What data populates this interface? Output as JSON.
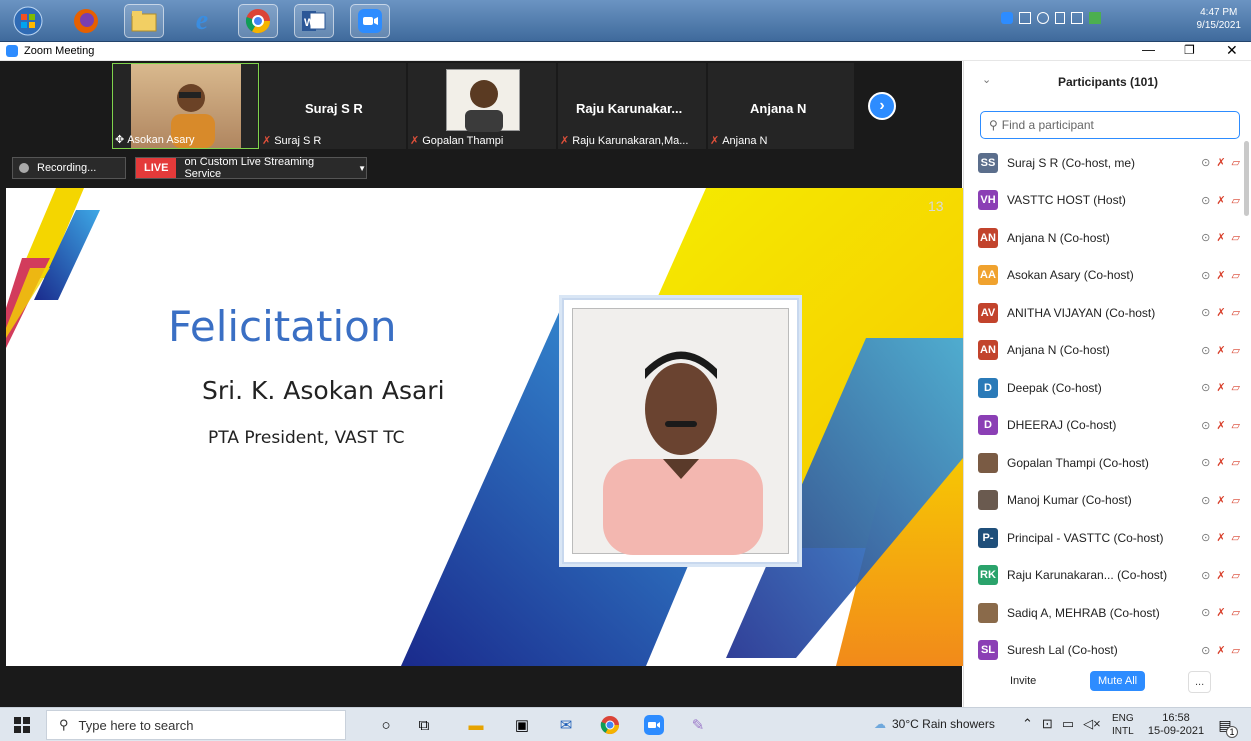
{
  "win7_taskbar": {
    "tray_time": "4:47 PM",
    "tray_date": "9/15/2021",
    "apps": [
      "start-orb-icon",
      "firefox-icon",
      "file-explorer-icon",
      "internet-explorer-icon",
      "chrome-icon",
      "word-icon",
      "zoom-icon"
    ]
  },
  "window": {
    "title": "Zoom Meeting"
  },
  "video_strip": {
    "tiles": [
      {
        "label": "Asokan Asary",
        "has_video": true
      },
      {
        "name": "Suraj S R",
        "label": "Suraj S R"
      },
      {
        "label": "Gopalan Thampi",
        "has_video": true
      },
      {
        "name": "Raju  Karunakar...",
        "label": "Raju Karunakaran,Ma..."
      },
      {
        "name": "Anjana N",
        "label": "Anjana N"
      }
    ]
  },
  "recording": {
    "label": "Recording...",
    "live": "LIVE",
    "stream": "on Custom Live Streaming Service"
  },
  "slide": {
    "page_number": "13",
    "title": "Felicitation",
    "name": "Sri. K. Asokan Asari",
    "role": "PTA President, VAST TC"
  },
  "participants": {
    "header": "Participants (101)",
    "search_placeholder": "Find a participant",
    "list": [
      {
        "initials": "SS",
        "name": "Suraj S R (Co-host, me)",
        "color": "#5b6e8c"
      },
      {
        "initials": "VH",
        "name": "VASTTC HOST (Host)",
        "color": "#8b3fb5"
      },
      {
        "initials": "AN",
        "name": "Anjana N (Co-host)",
        "color": "#c2432c"
      },
      {
        "initials": "AA",
        "name": "Asokan Asary (Co-host)",
        "color": "#f0a22e"
      },
      {
        "initials": "AV",
        "name": "ANITHA VIJAYAN (Co-host)",
        "color": "#c2432c"
      },
      {
        "initials": "AN",
        "name": "Anjana N (Co-host)",
        "color": "#c2432c"
      },
      {
        "initials": "D",
        "name": "Deepak (Co-host)",
        "color": "#2a7ab8"
      },
      {
        "initials": "D",
        "name": "DHEERAJ (Co-host)",
        "color": "#8b3fb5"
      },
      {
        "initials": "",
        "name": "Gopalan Thampi (Co-host)",
        "color": "#7a5b44"
      },
      {
        "initials": "",
        "name": "Manoj Kumar (Co-host)",
        "color": "#6a5a4f"
      },
      {
        "initials": "P-",
        "name": "Principal - VASTTC (Co-host)",
        "color": "#1f4f7a"
      },
      {
        "initials": "RK",
        "name": "Raju Karunakaran... (Co-host)",
        "color": "#2aa36b"
      },
      {
        "initials": "",
        "name": "Sadiq A, MEHRAB (Co-host)",
        "color": "#8a6a4a"
      },
      {
        "initials": "SL",
        "name": "Suresh Lal (Co-host)",
        "color": "#8b3fb5"
      }
    ],
    "invite": "Invite",
    "mute_all": "Mute All",
    "more": "..."
  },
  "win10_taskbar": {
    "search_placeholder": "Type here to search",
    "weather": "30°C  Rain showers",
    "lang1": "ENG",
    "lang2": "INTL",
    "time": "16:58",
    "date": "15-09-2021",
    "notif_count": "1"
  }
}
